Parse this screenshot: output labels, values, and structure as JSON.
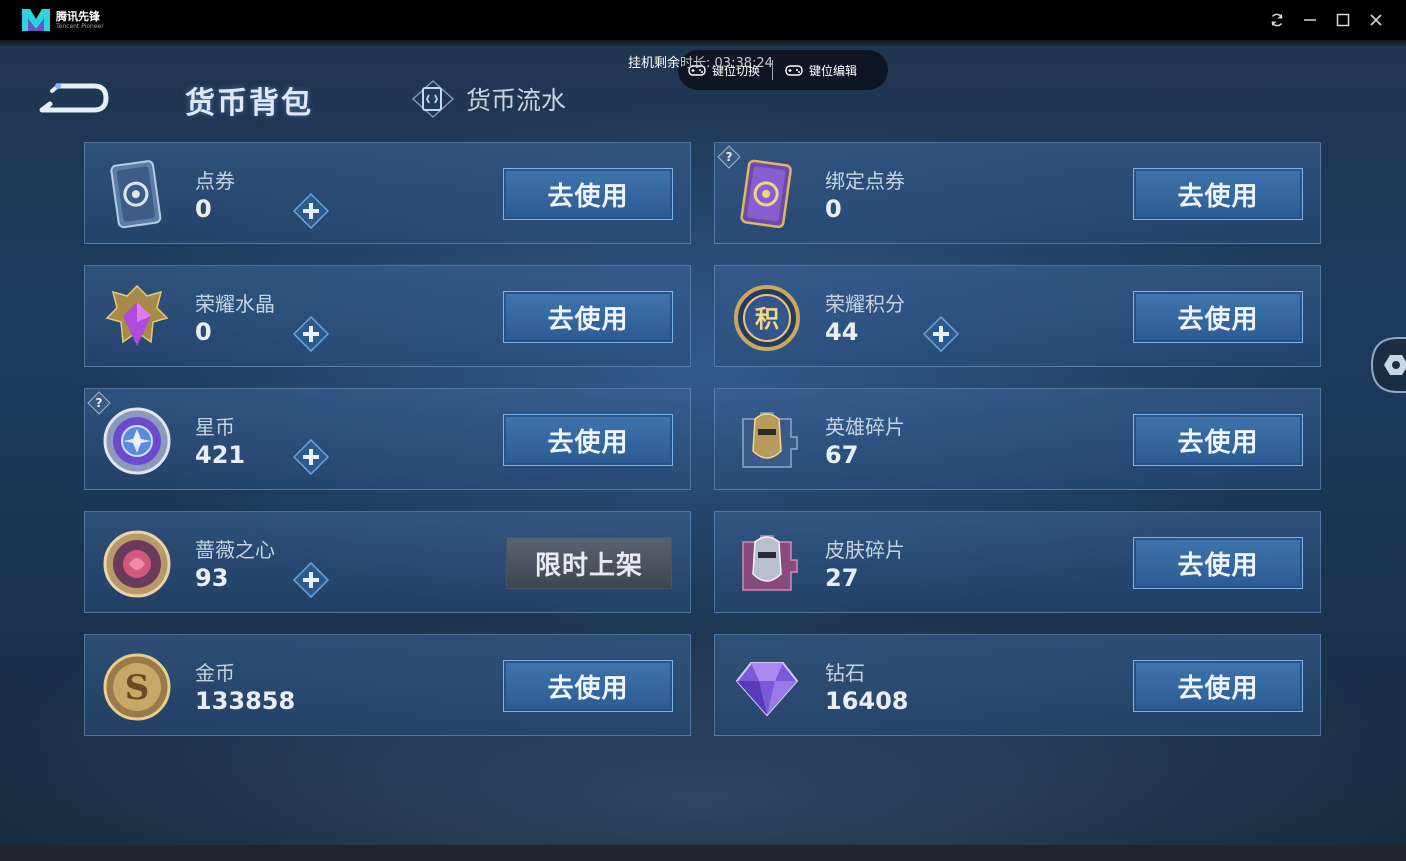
{
  "titlebar": {
    "brand_name": "腾讯先锋",
    "brand_sub": "Tencent Pioneer",
    "buttons": [
      "refresh-icon",
      "minimize-icon",
      "maximize-icon",
      "close-icon"
    ]
  },
  "overlay": {
    "afk_label": "挂机剩余",
    "afk_time": "时长: 03:38:24",
    "key_switch": "键位切换",
    "key_edit": "键位编辑"
  },
  "tabs": {
    "bag": "货币背包",
    "flow": "货币流水"
  },
  "colors": {
    "accent_button": "#3f74ad",
    "button_border": "#79b3ea",
    "disabled_button": "#4b5560",
    "card_bg": "#2f5687"
  },
  "currencies": [
    {
      "name": "点券",
      "amount": "0",
      "icon": "coupon-ticket-icon",
      "plus": true,
      "help": false,
      "button": "去使用"
    },
    {
      "name": "绑定点券",
      "amount": "0",
      "icon": "bound-coupon-ticket-icon",
      "plus": false,
      "help": true,
      "button": "去使用"
    },
    {
      "name": "荣耀水晶",
      "amount": "0",
      "icon": "glory-crystal-icon",
      "plus": true,
      "help": false,
      "button": "去使用"
    },
    {
      "name": "荣耀积分",
      "amount": "44",
      "icon": "glory-points-icon",
      "plus": true,
      "help": false,
      "button": "去使用"
    },
    {
      "name": "星币",
      "amount": "421",
      "icon": "star-coin-icon",
      "plus": true,
      "help": true,
      "button": "去使用"
    },
    {
      "name": "英雄碎片",
      "amount": "67",
      "icon": "hero-fragment-icon",
      "plus": false,
      "help": false,
      "button": "去使用"
    },
    {
      "name": "蔷薇之心",
      "amount": "93",
      "icon": "rose-heart-icon",
      "plus": true,
      "help": false,
      "button": "限时上架"
    },
    {
      "name": "皮肤碎片",
      "amount": "27",
      "icon": "skin-fragment-icon",
      "plus": false,
      "help": false,
      "button": "去使用"
    },
    {
      "name": "金币",
      "amount": "133858",
      "icon": "gold-coin-icon",
      "plus": false,
      "help": false,
      "button": "去使用"
    },
    {
      "name": "钻石",
      "amount": "16408",
      "icon": "diamond-icon",
      "plus": false,
      "help": false,
      "button": "去使用"
    }
  ]
}
